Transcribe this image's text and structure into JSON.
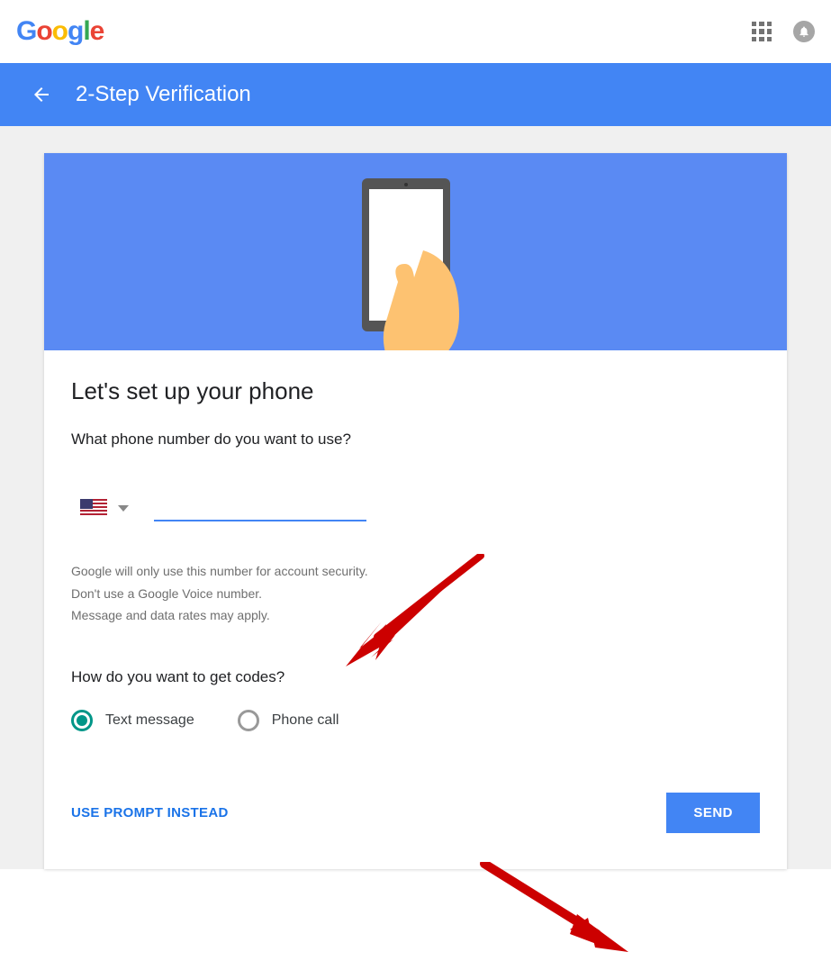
{
  "header": {
    "logo_text": "Google"
  },
  "titlebar": {
    "title": "2-Step Verification"
  },
  "main": {
    "heading": "Let's set up your phone",
    "subheading": "What phone number do you want to use?",
    "phone_value": "",
    "helper_line1": "Google will only use this number for account security.",
    "helper_line2": "Don't use a Google Voice number.",
    "helper_line3": "Message and data rates may apply.",
    "codes_heading": "How do you want to get codes?",
    "radio_text_message": "Text message",
    "radio_phone_call": "Phone call",
    "use_prompt_label": "USE PROMPT INSTEAD",
    "send_label": "SEND"
  },
  "colors": {
    "accent": "#4285f4",
    "teal": "#009688"
  }
}
